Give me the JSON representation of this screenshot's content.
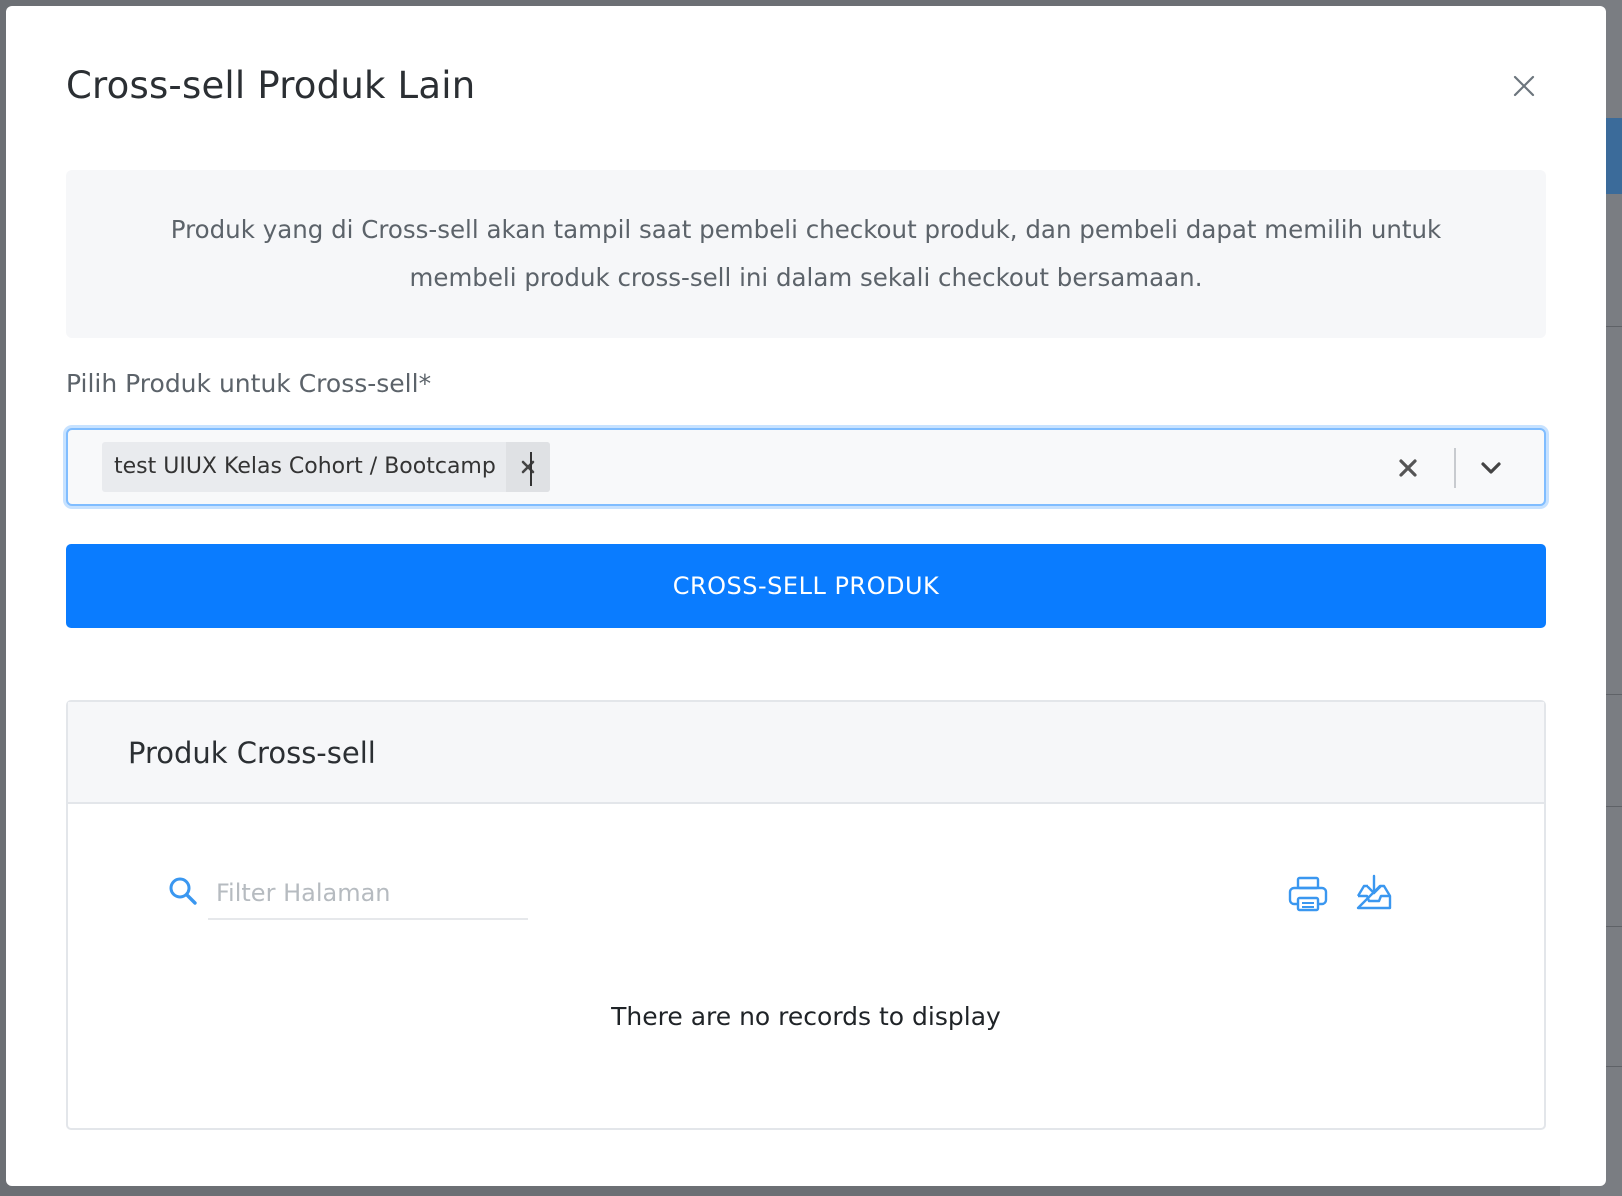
{
  "modal": {
    "title": "Cross-sell Produk Lain",
    "close_icon": "close-icon",
    "info_text": "Produk yang di Cross-sell akan tampil saat pembeli checkout produk, dan pembeli dapat memilih untuk membeli produk cross-sell ini dalam sekali checkout bersamaan."
  },
  "form": {
    "label": "Pilih Produk untuk Cross-sell*",
    "selected_items": [
      {
        "label": "test UIUX Kelas Cohort / Bootcamp"
      }
    ],
    "input_value": "",
    "clear_icon": "clear-x-icon",
    "dropdown_icon": "chevron-down-icon"
  },
  "actions": {
    "cross_sell_button": "CROSS-SELL PRODUK"
  },
  "table_card": {
    "title": "Produk Cross-sell",
    "filter_placeholder": "Filter Halaman",
    "filter_value": "",
    "search_icon": "search-icon",
    "print_icon": "printer-icon",
    "export_icon": "download-tray-icon",
    "empty_message": "There are no records to display"
  },
  "colors": {
    "primary": "#0a7cff",
    "icon_blue": "#3a97f0",
    "focus_border": "#80bdff"
  }
}
